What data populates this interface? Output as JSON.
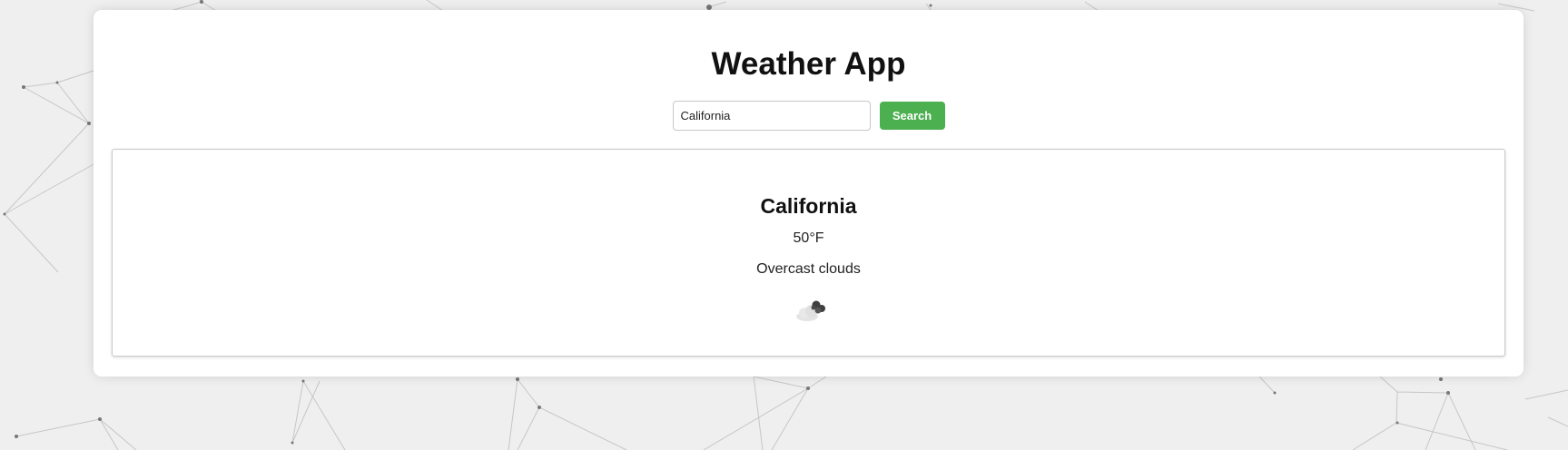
{
  "header": {
    "title": "Weather App"
  },
  "search": {
    "value": "California",
    "button_label": "Search"
  },
  "result": {
    "city": "California",
    "temperature": "50°F",
    "description": "Overcast clouds",
    "icon": "overcast-clouds-icon"
  },
  "colors": {
    "accent": "#4caf50",
    "background": "#efefef",
    "card": "#ffffff"
  }
}
